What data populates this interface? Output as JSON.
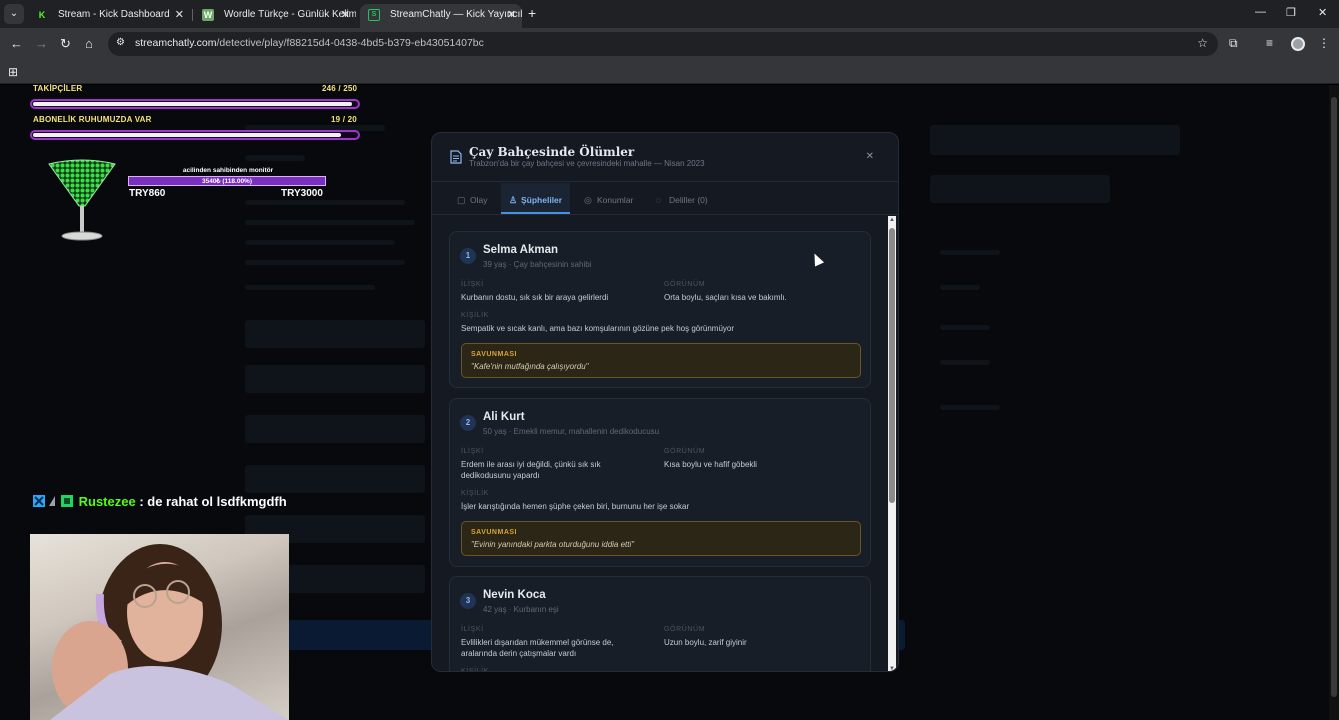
{
  "browser": {
    "tabs": [
      {
        "title": "Stream - Kick Dashboard",
        "favicon": "K",
        "favicon_color": "#53fc18",
        "active": false
      },
      {
        "title": "Wordle Türkçe - Günlük Kelime",
        "favicon": "W",
        "favicon_color": "#6aaa64",
        "active": false
      },
      {
        "title": "StreamChatly — Kick Yayıncıları",
        "favicon": "S",
        "favicon_color": "#22c55e",
        "active": true
      }
    ],
    "url_host": "streamchatly.com",
    "url_path": "/detective/play/f88215d4-0438-4bd5-b379-eb43051407bc"
  },
  "overlay": {
    "followers_label": "TAKİPÇİLER",
    "followers_value": "246 / 250",
    "followers_progress": 0.984,
    "subs_label": "ABONELİK RUHUMUZDA VAR",
    "subs_value": "19 / 20",
    "subs_progress": 0.95,
    "goal_title": "acilinden sahibinden monitör",
    "goal_bar_text": "3540₺ (118.00%)",
    "goal_current": "TRY860",
    "goal_target": "TRY3000",
    "chat_user": "Rustezee",
    "chat_message": ": de rahat ol lsdfkmgdfh"
  },
  "modal": {
    "title": "Çay Bahçesinde Ölümler",
    "subtitle": "Trabzon'da bir çay bahçesi ve çevresindeki mahalle — Nisan 2023",
    "tabs": [
      {
        "label": "Olay",
        "icon": "book-icon"
      },
      {
        "label": "Şüpheliler",
        "icon": "users-icon",
        "active": true
      },
      {
        "label": "Konumlar",
        "icon": "map-pin-icon"
      },
      {
        "label": "Deliller (0)",
        "icon": "shield-icon"
      }
    ],
    "labels": {
      "relation": "İLİŞKİ",
      "appearance": "GÖRÜNÜM",
      "personality": "KİŞİLİK",
      "defense": "SAVUNMASI"
    },
    "suspects": [
      {
        "num": "1",
        "name": "Selma Akman",
        "meta": "39 yaş · Çay bahçesinin sahibi",
        "relation": "Kurbanın dostu, sık sık bir araya gelirlerdi",
        "appearance": "Orta boylu, saçları kısa ve bakımlı.",
        "personality": "Sempatik ve sıcak kanlı, ama bazı komşularının gözüne pek hoş görünmüyor",
        "defense": "\"Kafe'nin mutfağında çalışıyordu\""
      },
      {
        "num": "2",
        "name": "Ali Kurt",
        "meta": "50 yaş · Emekli memur, mahallenin dedikoducusu",
        "relation": "Erdem ile arası iyi değildi, çünkü sık sık dedikodusunu yapardı",
        "appearance": "Kısa boylu ve hafif göbekli",
        "personality": "İşler karıştığında hemen şüphe çeken biri, burnunu her işe sokar",
        "defense": "\"Evinin yanındaki parkta oturduğunu iddia etti\""
      },
      {
        "num": "3",
        "name": "Nevin Koca",
        "meta": "42 yaş · Kurbanın eşi",
        "relation": "Evlilikleri dışarıdan mükemmel görünse de, aralarında derin çatışmalar vardı",
        "appearance": "Uzun boylu, zarif giyinir",
        "personality": "",
        "defense": ""
      }
    ]
  }
}
